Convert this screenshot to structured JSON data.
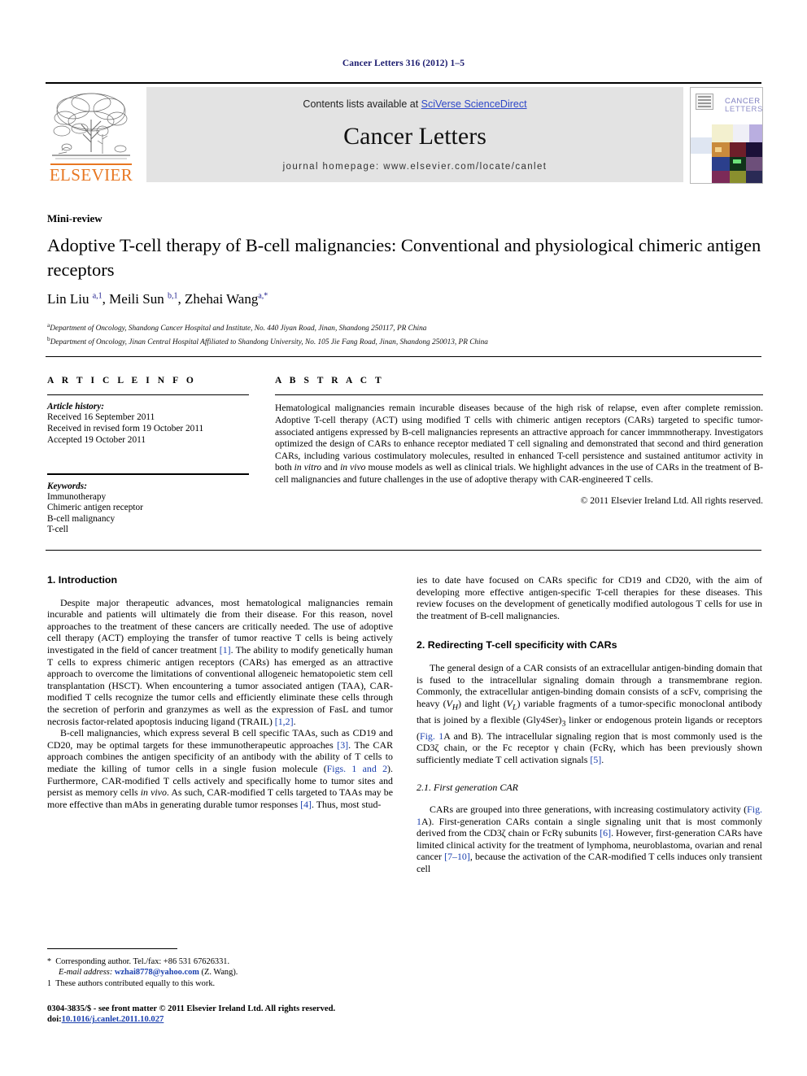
{
  "running_head": "Cancer Letters 316 (2012) 1–5",
  "masthead": {
    "contents_prefix": "Contents lists available at ",
    "sciencedirect": "SciVerse ScienceDirect",
    "journal_name": "Cancer Letters",
    "homepage": "journal homepage: www.elsevier.com/locate/canlet",
    "publisher": "ELSEVIER",
    "cover_title_line1": "CANCER",
    "cover_title_line2": "LETTERS"
  },
  "article": {
    "type_label": "Mini-review",
    "title": "Adoptive T-cell therapy of B-cell malignancies: Conventional and physiological chimeric antigen receptors",
    "authors_html": "Lin Liu <sup>a,1</sup>, Meili Sun <sup>b,1</sup>, Zhehai Wang<sup>a,*</sup>",
    "affiliations": [
      {
        "mark": "a",
        "text": "Department of Oncology, Shandong Cancer Hospital and Institute, No. 440 Jiyan Road, Jinan, Shandong 250117, PR China"
      },
      {
        "mark": "b",
        "text": "Department of Oncology, Jinan Central Hospital Affiliated to Shandong University, No. 105 Jie Fang Road, Jinan, Shandong 250013, PR China"
      }
    ]
  },
  "article_info": {
    "heading": "A R T I C L E    I N F O",
    "history_label": "Article history:",
    "history": [
      "Received 16 September 2011",
      "Received in revised form 19 October 2011",
      "Accepted 19 October 2011"
    ],
    "keywords_label": "Keywords:",
    "keywords": [
      "Immunotherapy",
      "Chimeric antigen receptor",
      "B-cell malignancy",
      "T-cell"
    ]
  },
  "abstract": {
    "heading": "A B S T R A C T",
    "body_html": "Hematological malignancies remain incurable diseases because of the high risk of relapse, even after complete remission. Adoptive T-cell therapy (ACT) using modified T cells with chimeric antigen receptors (CARs) targeted to specific tumor-associated antigens expressed by B-cell malignancies represents an attractive approach for cancer immmnotherapy. Investigators optimized the design of CARs to enhance receptor mediated T cell signaling and demonstrated that second and third generation CARs, including various costimulatory molecules, resulted in enhanced T-cell persistence and sustained antitumor activity in both <span class=\"it\">in vitro</span> and <span class=\"it\">in vivo</span> mouse models as well as clinical trials. We highlight advances in the use of CARs in the treatment of B-cell malignancies and future challenges in the use of adoptive therapy with CAR-engineered T cells.",
    "copyright": "© 2011 Elsevier Ireland Ltd. All rights reserved."
  },
  "body": {
    "left": {
      "section1_heading": "1. Introduction",
      "para1_html": "Despite major therapeutic advances, most hematological malignancies remain incurable and patients will ultimately die from their disease. For this reason, novel approaches to the treatment of these cancers are critically needed. The use of adoptive cell therapy (ACT) employing the transfer of tumor reactive T cells is being actively investigated in the field of cancer treatment <span class=\"cite\">[1]</span>. The ability to modify genetically human T cells to express chimeric antigen receptors (CARs) has emerged as an attractive approach to overcome the limitations of conventional allogeneic hematopoietic stem cell transplantation (HSCT). When encountering a tumor associated antigen (TAA), CAR-modified T cells recognize the tumor cells and efficiently eliminate these cells through the secretion of perforin and granzymes as well as the expression of FasL and tumor necrosis factor-related apoptosis inducing ligand (TRAIL) <span class=\"cite\">[1,2]</span>.",
      "para2_html": "B-cell malignancies, which express several B cell specific TAAs, such as CD19 and CD20, may be optimal targets for these immunotherapeutic approaches <span class=\"cite\">[3]</span>. The CAR approach combines the antigen specificity of an antibody with the ability of T cells to mediate the killing of tumor cells in a single fusion molecule (<span class=\"cite\">Figs. 1 and 2</span>). Furthermore, CAR-modified T cells actively and specifically home to tumor sites and persist as memory cells <span class=\"it\">in vivo</span>. As such, CAR-modified T cells targeted to TAAs may be more effective than mAbs in generating durable tumor responses <span class=\"cite\">[4]</span>. Thus, most stud-"
    },
    "right": {
      "para_continued_html": "ies to date have focused on CARs specific for CD19 and CD20, with the aim of developing more effective antigen-specific T-cell therapies for these diseases. This review focuses on the development of genetically modified autologous T cells for use in the treatment of B-cell malignancies.",
      "section2_heading": "2. Redirecting T-cell specificity with CARs",
      "para1_html": "The general design of a CAR consists of an extracellular antigen-binding domain that is fused to the intracellular signaling domain through a transmembrane region. Commonly, the extracellular antigen-binding domain consists of a scFv, comprising the heavy (<span class=\"it\">V</span><sub class=\"it\">H</sub>) and light (<span class=\"it\">V</span><sub class=\"it\">L</sub>) variable fragments of a tumor-specific monoclonal antibody that is joined by a flexible (Gly4Ser)<sub>3</sub> linker or endogenous protein ligands or receptors (<span class=\"cite\">Fig. 1</span>A and B). The intracellular signaling region that is most commonly used is the CD3ζ chain, or the Fc receptor γ chain (FcRγ, which has been previously shown sufficiently mediate T cell activation signals <span class=\"cite\">[5]</span>.",
      "subsection_heading": "2.1. First generation CAR",
      "para2_html": "CARs are grouped into three generations, with increasing costimulatory activity (<span class=\"cite\">Fig. 1</span>A). First-generation CARs contain a single signaling unit that is most commonly derived from the CD3ζ chain or FcRγ subunits <span class=\"cite\">[6]</span>. However, first-generation CARs have limited clinical activity for the treatment of lymphoma, neuroblastoma, ovarian and renal cancer <span class=\"cite\">[7–10]</span>, because the activation of the CAR-modified T cells induces only transient cell"
    }
  },
  "footnotes": {
    "corresponding_html": "<span class=\"mark\">*</span> &nbsp;Corresponding author. Tel./fax: +86 531 67626331.",
    "email_html": "<span class=\"it\">E-mail address:</span> <span class=\"email-link\">wzhai8778@yahoo.com</span> (Z. Wang).",
    "equal_contrib_html": "<span class=\"mark\">1</span> &nbsp;These authors contributed equally to this work."
  },
  "imprint": {
    "line1": "0304-3835/$ - see front matter © 2011 Elsevier Ireland Ltd. All rights reserved.",
    "doi_prefix": "doi:",
    "doi": "10.1016/j.canlet.2011.10.027"
  }
}
